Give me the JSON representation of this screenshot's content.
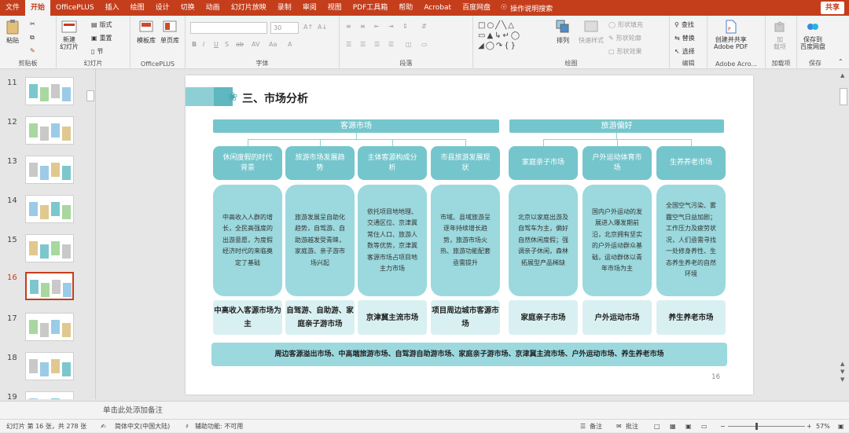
{
  "menu": {
    "tabs": [
      "文件",
      "开始",
      "OfficePLUS",
      "插入",
      "绘图",
      "设计",
      "切换",
      "动画",
      "幻灯片放映",
      "录制",
      "审阅",
      "视图",
      "PDF工具箱",
      "帮助",
      "Acrobat",
      "百度网盘"
    ],
    "active_tab": "开始",
    "search": "操作说明搜索",
    "share": "共享"
  },
  "ribbon": {
    "paste": "粘贴",
    "clipboard": "剪贴板",
    "new_slide": "新建\n幻灯片",
    "layout": "版式",
    "reset": "重置",
    "section": "节",
    "slides_group": "幻灯片",
    "template_lib": "模板库",
    "single_page_lib": "单页库",
    "officeplus_group": "OfficePLUS",
    "font_size": "30",
    "font_group": "字体",
    "paragraph_group": "段落",
    "arrange": "排列",
    "quick_styles": "快速样式",
    "shape_fill": "形状填充",
    "shape_outline": "形状轮廓",
    "shape_effects": "形状效果",
    "drawing_group": "绘图",
    "find": "查找",
    "replace": "替换",
    "select": "选择",
    "editing_group": "编辑",
    "create_share": "创建并共享\nAdobe PDF",
    "adobe_group": "Adobe Acro...",
    "load": "加\n载项",
    "addins_group": "加载项",
    "save_baidu": "保存到\n百度网盘",
    "save_group": "保存"
  },
  "thumbnails": [
    "11",
    "12",
    "13",
    "14",
    "15",
    "16",
    "17",
    "18",
    "19"
  ],
  "selected_thumbnail": "16",
  "slide": {
    "title": "三、市场分析",
    "source_header": "客源市场",
    "travel_header": "旅游偏好",
    "columns": [
      {
        "cat": "休闲度假的时代背景",
        "desc": "中高收入人群的增长，全民高强度的出游意愿，为度假经济时代的来临奠定了基础",
        "concl": "中高收入客源市场为主"
      },
      {
        "cat": "旅游市场发展趋势",
        "desc": "旅游发展呈自助化趋势，自驾游、自助游越发受青睐，家庭游、亲子游市场兴起",
        "concl": "自驾游、自助游、家庭亲子游市场"
      },
      {
        "cat": "主体客源构成分析",
        "desc": "依托项目地地理、交通区位、京津冀常住人口、旅游人数等优势，京津冀客源市场占项目地主力市场",
        "concl": "京津冀主流市场"
      },
      {
        "cat": "市县旅游发展现状",
        "desc": "市域、县域旅游呈逐年持续增长趋势，旅游市场火热、旅游功能配套亟需提升",
        "concl": "项目周边城市客源市场"
      },
      {
        "cat": "家庭亲子市场",
        "desc": "北京以家庭出游及自驾车为主，偏好自然休闲度假；强调亲子休闲，森林拓展型产品稀缺",
        "concl": "家庭亲子市场"
      },
      {
        "cat": "户外运动体育市场",
        "desc": "国内户外运动的发展进入爆发期前沿，北京拥有坚实的户外运动群众基础，运动群体以青年市场为主",
        "concl": "户外运动市场"
      },
      {
        "cat": "生养养老市场",
        "desc": "全国空气污染、雾霾空气日益加剧；工作压力及疲劳状况，人们亟需寻找一处修身养性、生态养生养老的自然环境",
        "concl": "养生养老市场"
      }
    ],
    "summary": "周边客源溢出市场、中高端旅游市场、自驾游自助游市场、家庭亲子游市场、京津冀主流市场、户外运动市场、养生养老市场",
    "page_number": "16"
  },
  "notes_placeholder": "单击此处添加备注",
  "status": {
    "slide_info": "幻灯片 第 16 张，共 278 张",
    "language": "简体中文(中国大陆)",
    "accessibility": "辅助功能: 不可用",
    "notes": "备注",
    "comments": "批注",
    "zoom": "57%"
  }
}
